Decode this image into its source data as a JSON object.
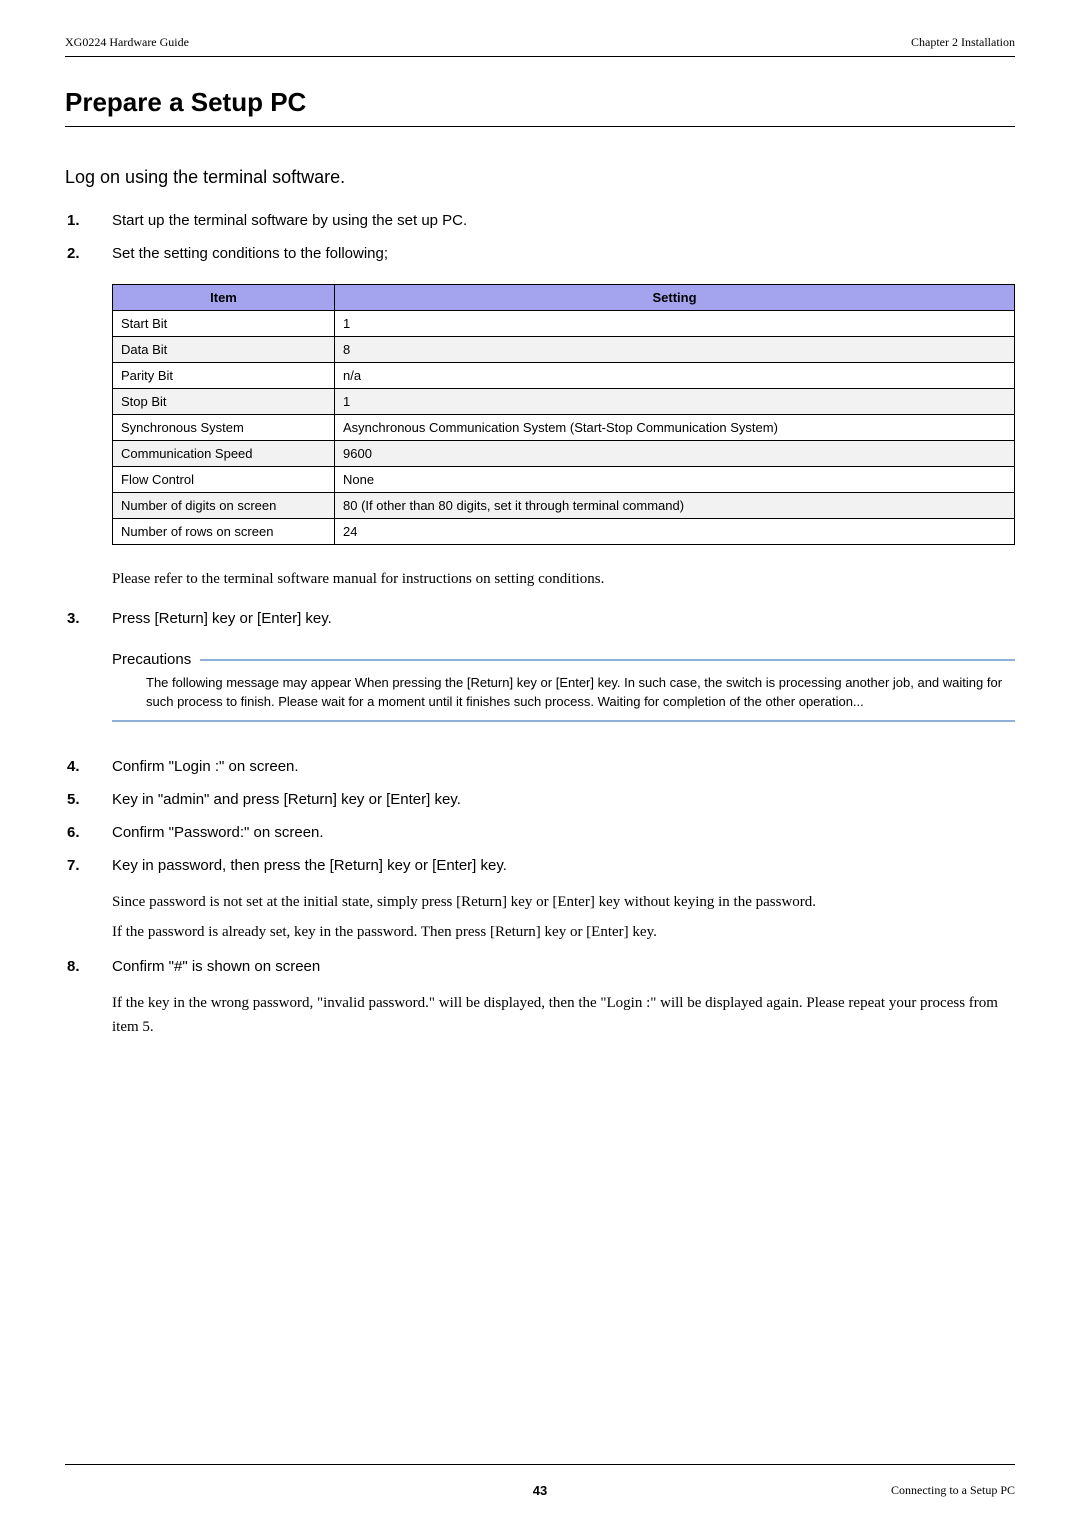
{
  "header": {
    "left": "XG0224 Hardware Guide",
    "right": "Chapter 2 Installation"
  },
  "title": "Prepare a Setup PC",
  "subtitle": "Log on using the terminal software.",
  "steps": {
    "s1": {
      "num": "1.",
      "text": "Start up the terminal software by using the set up PC."
    },
    "s2": {
      "num": "2.",
      "text": "Set the setting conditions to the following;"
    },
    "s3": {
      "num": "3.",
      "text": "Press [Return] key or [Enter] key."
    },
    "s4": {
      "num": "4.",
      "text": "Confirm \"Login :\" on screen."
    },
    "s5": {
      "num": "5.",
      "text": "Key in \"admin\" and press [Return] key or [Enter] key."
    },
    "s6": {
      "num": "6.",
      "text": "Confirm \"Password:\" on screen."
    },
    "s7": {
      "num": "7.",
      "text": "Key in password, then press the [Return] key or [Enter] key."
    },
    "s8": {
      "num": "8.",
      "text": "Confirm \"#\" is shown on screen"
    }
  },
  "table": {
    "head": {
      "item": "Item",
      "setting": "Setting"
    },
    "rows": [
      {
        "item": "Start Bit",
        "setting": "1"
      },
      {
        "item": "Data Bit",
        "setting": "8"
      },
      {
        "item": "Parity Bit",
        "setting": "n/a"
      },
      {
        "item": "Stop Bit",
        "setting": "1"
      },
      {
        "item": "Synchronous System",
        "setting": "Asynchronous Communication System (Start-Stop Communication System)"
      },
      {
        "item": "Communication Speed",
        "setting": "9600"
      },
      {
        "item": "Flow Control",
        "setting": "None"
      },
      {
        "item": "Number of digits on screen",
        "setting": "80  (If other than 80 digits, set it through terminal command)"
      },
      {
        "item": "Number of rows on screen",
        "setting": "24"
      }
    ]
  },
  "post_table_note": "Please refer to the terminal software manual for instructions on setting conditions.",
  "precautions": {
    "title": "Precautions",
    "body": "The following message may appear When pressing the [Return] key or [Enter] key. In such case, the switch is processing another job, and waiting for such process to finish. Please wait for a moment until it finishes such process. Waiting for completion of the other operation..."
  },
  "note7a": "Since password is not set at the initial state, simply press [Return] key or [Enter] key without keying in the password.",
  "note7b": "If the password is already set, key in the password. Then press [Return] key or [Enter] key.",
  "note8": "If the key in the wrong password, \"invalid password.\" will be displayed, then the \"Login :\" will be displayed again. Please repeat your process from item 5.",
  "footer": {
    "page": "43",
    "right": "Connecting to a Setup PC"
  }
}
